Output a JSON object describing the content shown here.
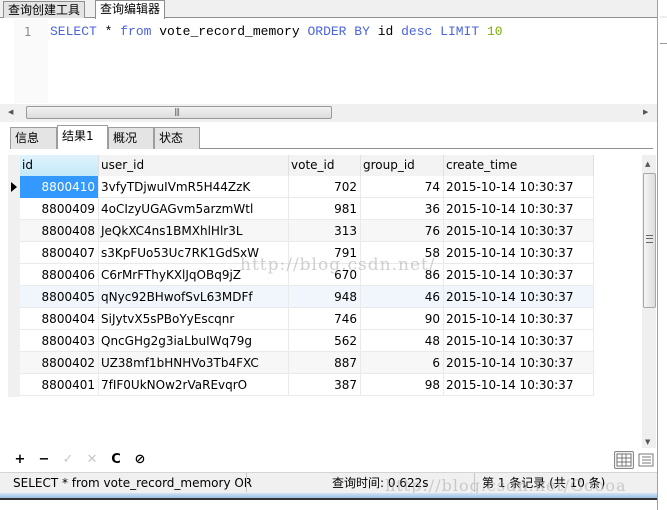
{
  "top_tabs": [
    {
      "label": "查询创建工具",
      "active": false
    },
    {
      "label": "查询编辑器",
      "active": true
    }
  ],
  "editor": {
    "line_number": "1",
    "tokens": {
      "t1": "SELECT",
      "t2": " * ",
      "t3": "from",
      "t4": " vote_record_memory ",
      "t5": "ORDER BY",
      "t6": " id ",
      "t7": "desc",
      "t8": " ",
      "t9": "LIMIT",
      "t10": " ",
      "t11": "10"
    }
  },
  "result_tabs": [
    {
      "label": "信息",
      "active": false
    },
    {
      "label": "结果1",
      "active": true
    },
    {
      "label": "概况",
      "active": false
    },
    {
      "label": "状态",
      "active": false
    }
  ],
  "grid": {
    "columns": [
      "id",
      "user_id",
      "vote_id",
      "group_id",
      "create_time"
    ],
    "rows": [
      [
        "8800410",
        "3vfyTDjwuIVmR5H44ZzK",
        "702",
        "74",
        "2015-10-14 10:30:37"
      ],
      [
        "8800409",
        "4oCIzyUGAGvm5arzmWtl",
        "981",
        "36",
        "2015-10-14 10:30:37"
      ],
      [
        "8800408",
        "JeQkXC4ns1BMXhlHlr3L",
        "313",
        "76",
        "2015-10-14 10:30:37"
      ],
      [
        "8800407",
        "s3KpFUo53Uc7RK1GdSxW",
        "791",
        "58",
        "2015-10-14 10:30:37"
      ],
      [
        "8800406",
        "C6rMrFThyKXlJqOBq9jZ",
        "670",
        "86",
        "2015-10-14 10:30:37"
      ],
      [
        "8800405",
        "qNyc92BHwofSvL63MDFf",
        "948",
        "46",
        "2015-10-14 10:30:37"
      ],
      [
        "8800404",
        "SiJytvX5sPBoYyEscqnr",
        "746",
        "90",
        "2015-10-14 10:30:37"
      ],
      [
        "8800403",
        "QncGHg2g3iaLbuIWq79g",
        "562",
        "48",
        "2015-10-14 10:30:37"
      ],
      [
        "8800402",
        "UZ38mf1bHNHVo3Tb4FXC",
        "887",
        "6",
        "2015-10-14 10:30:37"
      ],
      [
        "8800401",
        "7fIF0UkNOw2rVaREvqrO",
        "387",
        "98",
        "2015-10-14 10:30:37"
      ]
    ]
  },
  "toolbar": {
    "add": "+",
    "delete": "−",
    "apply": "✓",
    "cancel": "✕",
    "refresh": "C",
    "stop": "⊘"
  },
  "status": {
    "sql": "SELECT * from vote_record_memory OR",
    "query_time": "查询时间: 0.622s",
    "record": "第 1 条记录 (共 10 条)"
  },
  "watermark": "http://blog.csdn.net/",
  "watermark2": "http://blog.csdn.net/Goooa"
}
